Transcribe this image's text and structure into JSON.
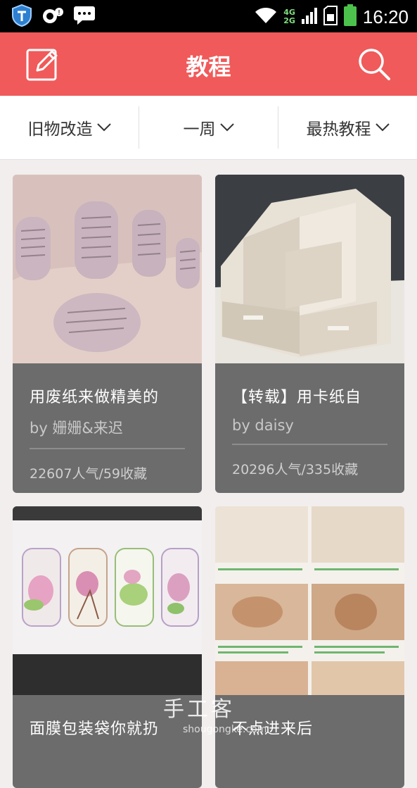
{
  "status_bar": {
    "time": "16:20",
    "network_top": "4G",
    "network_bottom": "2G",
    "icons": [
      "shield-icon",
      "camera-notification-icon",
      "chat-icon",
      "wifi-icon",
      "signal-icon",
      "sim-icon",
      "battery-icon"
    ]
  },
  "app_bar": {
    "title": "教程",
    "left_icon": "edit-icon",
    "right_icon": "search-icon",
    "color": "#f05a5a"
  },
  "filters": [
    {
      "label": "旧物改造"
    },
    {
      "label": "一周"
    },
    {
      "label": "最热教程"
    }
  ],
  "cards": [
    {
      "title": "用废纸来做精美的",
      "author": "by 姗姗&来迟",
      "stats": "22607人气/59收藏",
      "image": "newspaper-nail-art-photo"
    },
    {
      "title": "【转载】用卡纸自",
      "author": "by daisy",
      "stats": "20296人气/335收藏",
      "image": "cardboard-organizer-photo"
    },
    {
      "title": "面膜包装袋你就扔",
      "author": "",
      "stats": "",
      "image": "floral-bookmarks-photo"
    },
    {
      "title": "不点进来后",
      "author": "",
      "stats": "",
      "image": "fabric-pouch-steps-photo"
    }
  ],
  "watermark": {
    "text": "手工客",
    "url": "shougongke.com"
  }
}
